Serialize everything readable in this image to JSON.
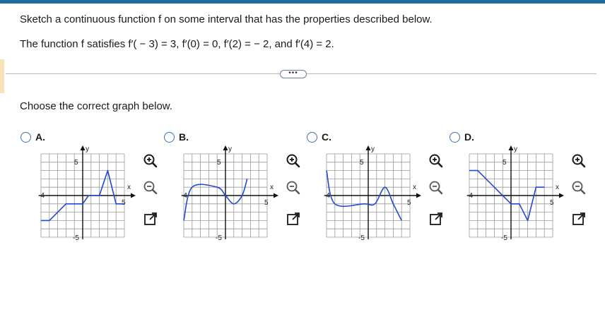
{
  "question": {
    "line1": "Sketch a continuous function f on some interval that has the properties described below.",
    "line2": "The function f satisfies f′( − 3) = 3, f′(0) = 0, f′(2) = − 2, and f′(4) = 2.",
    "more_label": "•••",
    "prompt": "Choose the correct graph below."
  },
  "axis_labels": {
    "x": "x",
    "y": "y",
    "x_min": "-4",
    "x_max": "5",
    "y_max": "5",
    "y_min": "-5"
  },
  "colors": {
    "curve": "#2546d8",
    "radio": "#3a6fb0",
    "grid": "#9a9a9a",
    "topbar": "#1e6fa0"
  },
  "tool_icons": [
    "zoom-in-icon",
    "zoom-out-icon",
    "open-external-icon"
  ],
  "choices": [
    {
      "id": "a",
      "label": "A.",
      "points": [
        [
          -5,
          -3
        ],
        [
          -4,
          -3
        ],
        [
          -2,
          -1
        ],
        [
          0,
          -1
        ],
        [
          0.7,
          0
        ],
        [
          2,
          0
        ],
        [
          3,
          3
        ],
        [
          4,
          -1
        ],
        [
          5,
          -1
        ]
      ],
      "curve": "line"
    },
    {
      "id": "b",
      "label": "B.",
      "points": [
        [
          -5,
          -3
        ],
        [
          -4,
          1
        ],
        [
          -1,
          1
        ],
        [
          0,
          0
        ],
        [
          1,
          -1
        ],
        [
          2,
          0
        ],
        [
          2.6,
          2
        ]
      ],
      "curve": "smooth"
    },
    {
      "id": "c",
      "label": "C.",
      "points": [
        [
          -5,
          3
        ],
        [
          -4,
          -1
        ],
        [
          -0.5,
          -1
        ],
        [
          0.8,
          -1
        ],
        [
          2,
          1
        ],
        [
          3,
          -1
        ],
        [
          4,
          -3
        ]
      ],
      "curve": "smooth"
    },
    {
      "id": "d",
      "label": "D.",
      "points": [
        [
          -5,
          3
        ],
        [
          -4,
          3
        ],
        [
          0,
          -1
        ],
        [
          1,
          -1
        ],
        [
          2,
          -3
        ],
        [
          3,
          1
        ],
        [
          4,
          1
        ]
      ],
      "curve": "line"
    }
  ]
}
